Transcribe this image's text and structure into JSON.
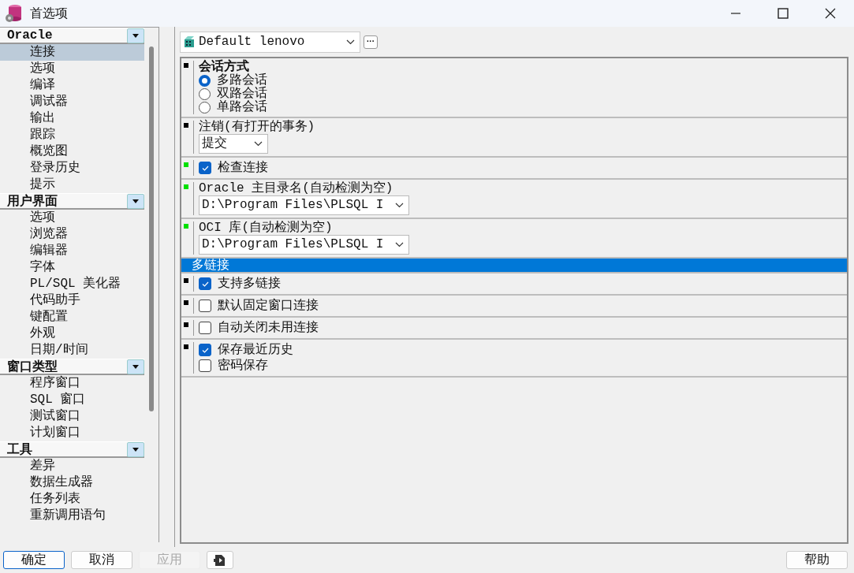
{
  "window": {
    "title": "首选项"
  },
  "sidebar": {
    "groups": [
      {
        "title": "Oracle",
        "items": [
          {
            "label": "连接",
            "selected": true
          },
          {
            "label": "选项",
            "selected": false
          },
          {
            "label": "编译",
            "selected": false
          },
          {
            "label": "调试器",
            "selected": false
          },
          {
            "label": "输出",
            "selected": false
          },
          {
            "label": "跟踪",
            "selected": false
          },
          {
            "label": "概览图",
            "selected": false
          },
          {
            "label": "登录历史",
            "selected": false
          },
          {
            "label": "提示",
            "selected": false
          }
        ]
      },
      {
        "title": "用户界面",
        "items": [
          {
            "label": "选项",
            "selected": false
          },
          {
            "label": "浏览器",
            "selected": false
          },
          {
            "label": "编辑器",
            "selected": false
          },
          {
            "label": "字体",
            "selected": false
          },
          {
            "label": "PL/SQL 美化器",
            "selected": false
          },
          {
            "label": "代码助手",
            "selected": false
          },
          {
            "label": "键配置",
            "selected": false
          },
          {
            "label": "外观",
            "selected": false
          },
          {
            "label": "日期/时间",
            "selected": false
          }
        ]
      },
      {
        "title": "窗口类型",
        "items": [
          {
            "label": "程序窗口",
            "selected": false
          },
          {
            "label": "SQL 窗口",
            "selected": false
          },
          {
            "label": "测试窗口",
            "selected": false
          },
          {
            "label": "计划窗口",
            "selected": false
          }
        ]
      },
      {
        "title": "工具",
        "items": [
          {
            "label": "差异",
            "selected": false
          },
          {
            "label": "数据生成器",
            "selected": false
          },
          {
            "label": "任务列表",
            "selected": false
          },
          {
            "label": "重新调用语句",
            "selected": false
          }
        ]
      }
    ]
  },
  "profile": {
    "value": "Default lenovo",
    "more": "···"
  },
  "settings": [
    {
      "kind": "radio_group",
      "color": "#000000",
      "title": "会话方式",
      "options": [
        {
          "label": "多路会话",
          "selected": true
        },
        {
          "label": "双路会话",
          "selected": false
        },
        {
          "label": "单路会话",
          "selected": false
        }
      ]
    },
    {
      "kind": "dropdown",
      "color": "#000000",
      "label": "注销(有打开的事务)",
      "value": "提交"
    },
    {
      "kind": "checkboxes",
      "color": "#00e000",
      "options": [
        {
          "label": "检查连接",
          "checked": true
        }
      ]
    },
    {
      "kind": "path",
      "color": "#00e000",
      "label": "Oracle 主目录名(自动检测为空)",
      "value": "D:\\Program Files\\PLSQL I"
    },
    {
      "kind": "path",
      "color": "#00e000",
      "label": "OCI 库(自动检测为空)",
      "value": "D:\\Program Files\\PLSQL I"
    },
    {
      "kind": "header",
      "title": "多链接"
    },
    {
      "kind": "checkboxes",
      "color": "#000000",
      "options": [
        {
          "label": "支持多链接",
          "checked": true
        }
      ]
    },
    {
      "kind": "checkboxes",
      "color": "#000000",
      "options": [
        {
          "label": "默认固定窗口连接",
          "checked": false
        }
      ]
    },
    {
      "kind": "checkboxes",
      "color": "#000000",
      "options": [
        {
          "label": "自动关闭未用连接",
          "checked": false
        }
      ]
    },
    {
      "kind": "checkboxes",
      "color": "#000000",
      "options": [
        {
          "label": "保存最近历史",
          "checked": true
        },
        {
          "label": "密码保存",
          "checked": false
        }
      ]
    }
  ],
  "buttons": [
    {
      "label": "确定",
      "kind": "default",
      "disabled": false
    },
    {
      "label": "取消",
      "kind": "normal",
      "disabled": false
    },
    {
      "label": "应用",
      "kind": "normal",
      "disabled": true
    },
    {
      "kind": "icon",
      "disabled": false
    },
    {
      "label": "帮助",
      "kind": "right",
      "disabled": false
    }
  ]
}
